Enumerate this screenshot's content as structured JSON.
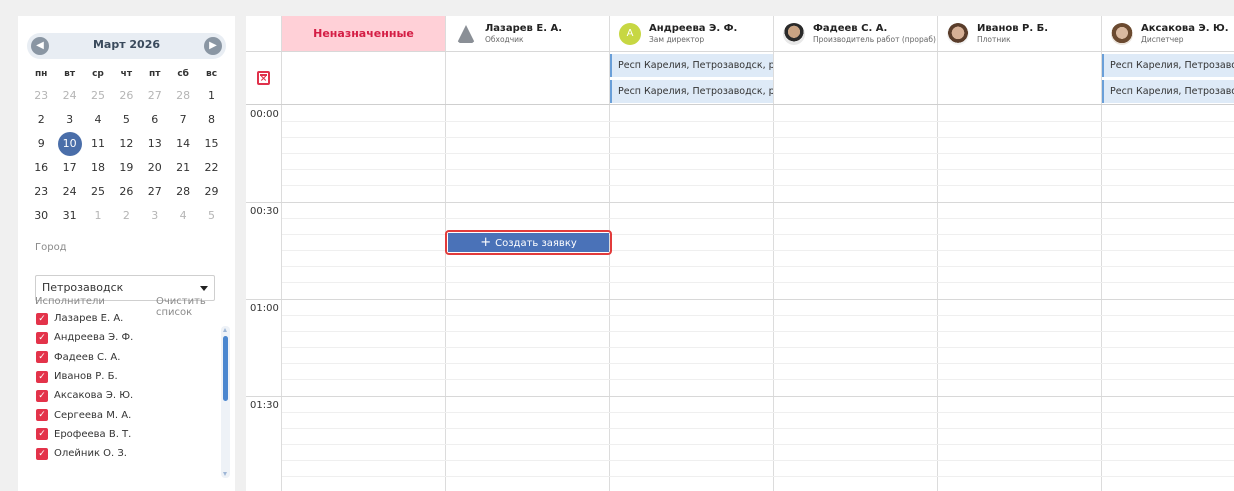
{
  "calendar": {
    "title": "Март 2026",
    "weekdays": [
      "пн",
      "вт",
      "ср",
      "чт",
      "пт",
      "сб",
      "вс"
    ],
    "weeks": [
      [
        "23",
        "24",
        "25",
        "26",
        "27",
        "28",
        "1"
      ],
      [
        "2",
        "3",
        "4",
        "5",
        "6",
        "7",
        "8"
      ],
      [
        "9",
        "10",
        "11",
        "12",
        "13",
        "14",
        "15"
      ],
      [
        "16",
        "17",
        "18",
        "19",
        "20",
        "21",
        "22"
      ],
      [
        "23",
        "24",
        "25",
        "26",
        "27",
        "28",
        "29"
      ],
      [
        "30",
        "31",
        "1",
        "2",
        "3",
        "4",
        "5"
      ]
    ],
    "selected_day": "10"
  },
  "filters": {
    "city_label": "Город",
    "city_value": "Петрозаводск",
    "executors_label": "Исполнители",
    "clear_label": "Очистить список",
    "executors": [
      "Лазарев Е. А.",
      "Андреева Э. Ф.",
      "Фадеев С. А.",
      "Иванов Р. Б.",
      "Аксакова Э. Ю.",
      "Сергеева М. А.",
      "Ерофеева В. Т.",
      "Олейник О. З."
    ]
  },
  "schedule": {
    "unassigned_label": "Неназначенные",
    "people": [
      {
        "name": "Лазарев Е. А.",
        "role": "Обходчик"
      },
      {
        "name": "Андреева Э. Ф.",
        "role": "Зам директор",
        "initial": "A"
      },
      {
        "name": "Фадеев С. А.",
        "role": "Производитель работ (прораб)"
      },
      {
        "name": "Иванов Р. Б.",
        "role": "Плотник"
      },
      {
        "name": "Аксакова Э. Ю.",
        "role": "Диспетчер"
      }
    ],
    "tasks": {
      "andreeva_1": "Респ Карелия, Петрозаводск, р-н",
      "andreeva_2": "Респ Карелия, Петрозаводск, р-н",
      "aksakova_1": "Респ Карелия, Петрозаводск, р-н",
      "aksakova_2": "Респ Карелия, Петрозаводск, р-н"
    },
    "times": [
      "00:00",
      "00:30",
      "01:00",
      "01:30"
    ],
    "create_label": "Создать заявку"
  },
  "colors": {
    "accent": "#e3334a",
    "primary": "#4a72b8",
    "unassigned_bg": "#ffd0d7"
  },
  "icons": {
    "calendar_cross": "calendar-x-icon",
    "plus": "plus-icon"
  }
}
